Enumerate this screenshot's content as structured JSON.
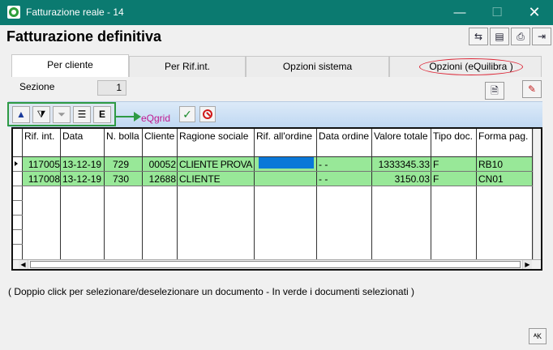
{
  "window": {
    "title": "Fatturazione reale - 14",
    "minimize": "—",
    "maximize": "☐",
    "close": "✕"
  },
  "form": {
    "title": "Fatturazione definitiva"
  },
  "header_icons": [
    "refresh-icon",
    "print-preview-icon",
    "print-icon",
    "exit-icon"
  ],
  "tabs": [
    {
      "label": "Per cliente",
      "active": true
    },
    {
      "label": "Per Rif.int.",
      "active": false
    },
    {
      "label": "Opzioni sistema",
      "active": false
    },
    {
      "label": "Opzioni (eQuilibra )",
      "active": false
    }
  ],
  "sezione": {
    "label": "Sezione",
    "value": "1"
  },
  "grid_toolbar": {
    "icons": [
      "sort-up-icon",
      "filter-edit-icon",
      "filter-icon",
      "columns-icon",
      "export-icon"
    ],
    "annotation": "eQgrid"
  },
  "grid": {
    "columns": [
      "Rif. int.",
      "Data",
      "N. bolla",
      "Cliente",
      "Ragione sociale",
      "Rif. all'ordine",
      "Data ordine",
      "Valore totale",
      "Tipo doc.",
      "Forma pag."
    ],
    "rows": [
      [
        "117005",
        "13-12-19",
        "729",
        "00052",
        "CLIENTE PROVA",
        "",
        "- -",
        "1333345.33",
        "F",
        "RB10"
      ],
      [
        "117008",
        "13-12-19",
        "730",
        "12688",
        "CLIENTE",
        "",
        "- -",
        "3150.03",
        "F",
        "CN01"
      ]
    ]
  },
  "status_text": "( Doppio click per selezionare/deselezionare un documento - In verde i documenti selezionati )",
  "corner_button": "ᴬK",
  "colors": {
    "titlebar": "#0b7a70",
    "selected_row": "#98e898",
    "accent_green": "#2e9a44",
    "annotation": "#c01890"
  }
}
